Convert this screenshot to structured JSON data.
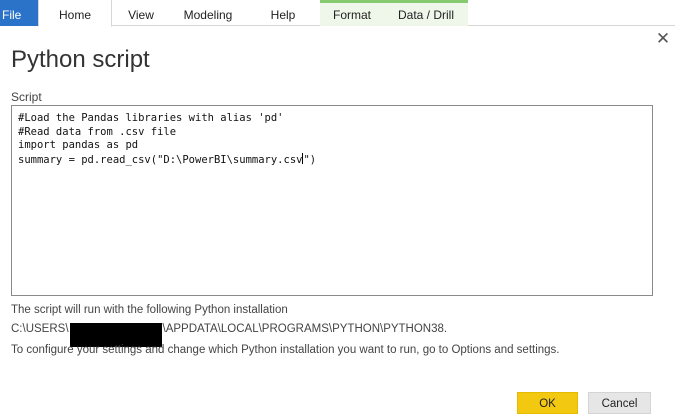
{
  "ribbon": {
    "tabs": [
      {
        "label": "File"
      },
      {
        "label": "Home"
      },
      {
        "label": "View"
      },
      {
        "label": "Modeling"
      },
      {
        "label": "Help"
      },
      {
        "label": "Format"
      },
      {
        "label": "Data / Drill"
      }
    ],
    "file_color": "#2b73c8",
    "context_accent": "#86c96f"
  },
  "dialog": {
    "title": "Python script",
    "close_icon": "close-icon",
    "script_label": "Script",
    "code_lines": [
      "#Load the Pandas libraries with alias 'pd'",
      "#Read data from .csv file",
      "import pandas as pd",
      "summary = pd.read_csv(\"D:\\PowerBI\\summary.csv",
      "\")"
    ],
    "info_line1": "The script will run with the following Python installation",
    "path_prefix": "C:\\USERS\\",
    "path_suffix": "\\APPDATA\\LOCAL\\PROGRAMS\\PYTHON\\PYTHON38.",
    "info_line3": "To configure your settings and change which Python installation you want to run, go to Options and settings.",
    "ok_label": "OK",
    "cancel_label": "Cancel",
    "ok_color": "#f2c811"
  }
}
